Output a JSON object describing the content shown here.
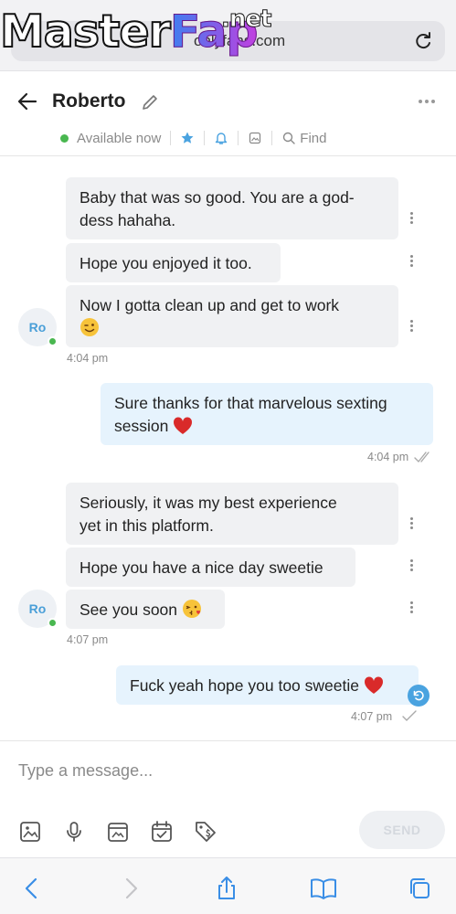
{
  "browser": {
    "url": "onlyfans.com",
    "watermark_main": "MasterFap",
    "watermark_a": "Master",
    "watermark_b": "Fap",
    "watermark_suffix": ".net",
    "icons": [
      "reload-icon",
      "back-icon",
      "forward-icon",
      "share-icon",
      "bookmarks-icon",
      "tabs-icon"
    ]
  },
  "header": {
    "contact_name": "Roberto",
    "status": "Available now",
    "find_label": "Find",
    "icons": [
      "back-arrow-icon",
      "edit-icon",
      "more-icon",
      "star-icon",
      "bell-icon",
      "image-icon",
      "search-icon"
    ],
    "accent": "#4aa3e0",
    "online_color": "#49b750"
  },
  "messages": {
    "group1": {
      "m1": "Baby that was so good. You are a god-dess hahaha.",
      "m1_line1": "Baby that was so good. You are a god-",
      "m1_line2": "dess hahaha.",
      "m2": "Hope you enjoyed it too.",
      "m3": "Now I gotta clean up and get to work",
      "avatar": "Ro",
      "time": "4:04 pm"
    },
    "out1": {
      "line1": "Sure thanks for that marvelous sexting",
      "line2": "session",
      "time": "4:04 pm"
    },
    "group2": {
      "m1_line1": "Seriously, it was my best experience",
      "m1_line2": "yet in this platform.",
      "m2": "Hope you have a nice day sweetie",
      "m3": "See you soon",
      "avatar": "Ro",
      "time": "4:07 pm"
    },
    "out2": {
      "text": "Fuck yeah hope you too sweetie",
      "time": "4:07 pm"
    }
  },
  "compose": {
    "placeholder": "Type a message...",
    "send_label": "SEND",
    "tools": [
      "image-icon",
      "microphone-icon",
      "vault-icon",
      "calendar-icon",
      "price-tag-icon"
    ]
  }
}
